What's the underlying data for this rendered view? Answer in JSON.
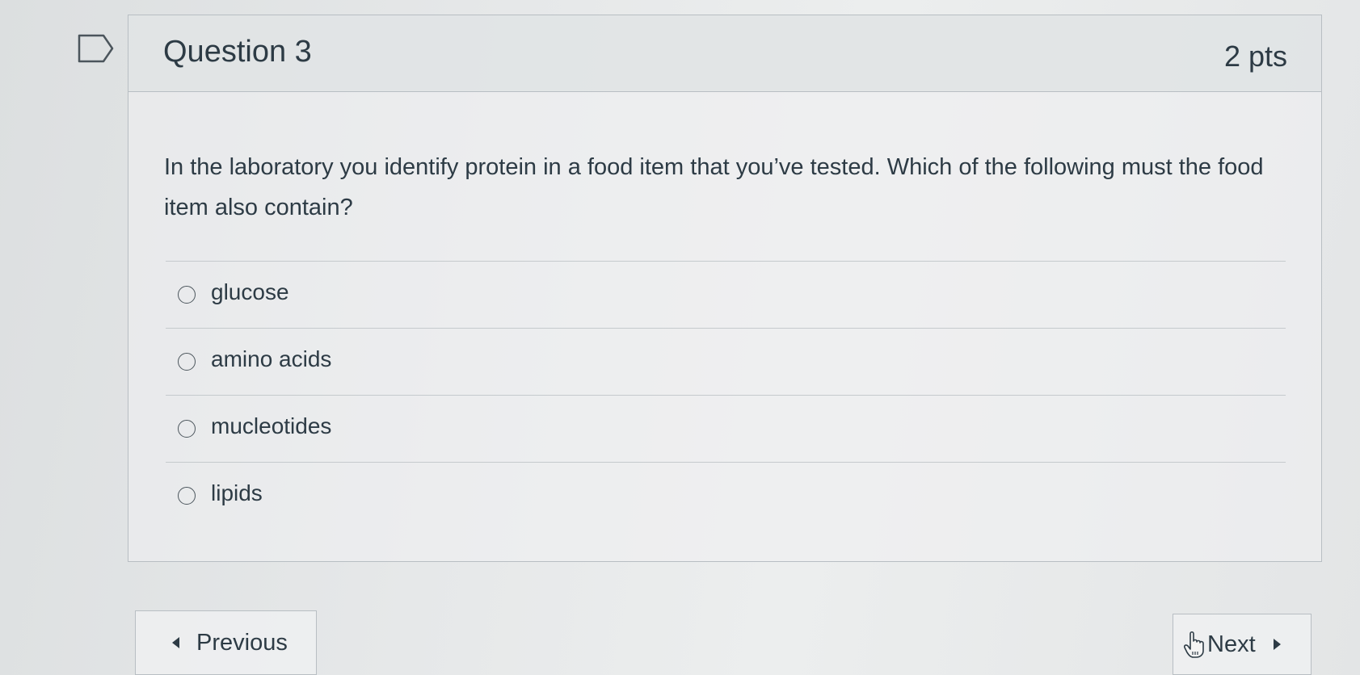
{
  "question": {
    "title": "Question 3",
    "points": "2 pts",
    "text": "In the laboratory you identify protein in a food item that you’ve tested. Which of the following must the food item also contain?"
  },
  "answers": [
    {
      "label": "glucose",
      "selected": false
    },
    {
      "label": "amino acids",
      "selected": false
    },
    {
      "label": "mucleotides",
      "selected": false
    },
    {
      "label": "lipids",
      "selected": false
    }
  ],
  "navigation": {
    "previous_label": "Previous",
    "next_label": "Next"
  },
  "icons": {
    "flag": "flag-icon",
    "previous": "arrow-left-icon",
    "next": "arrow-right-icon",
    "cursor": "hand-cursor-icon"
  },
  "colors": {
    "text": "#2d3b45",
    "border": "#b8bec3"
  }
}
